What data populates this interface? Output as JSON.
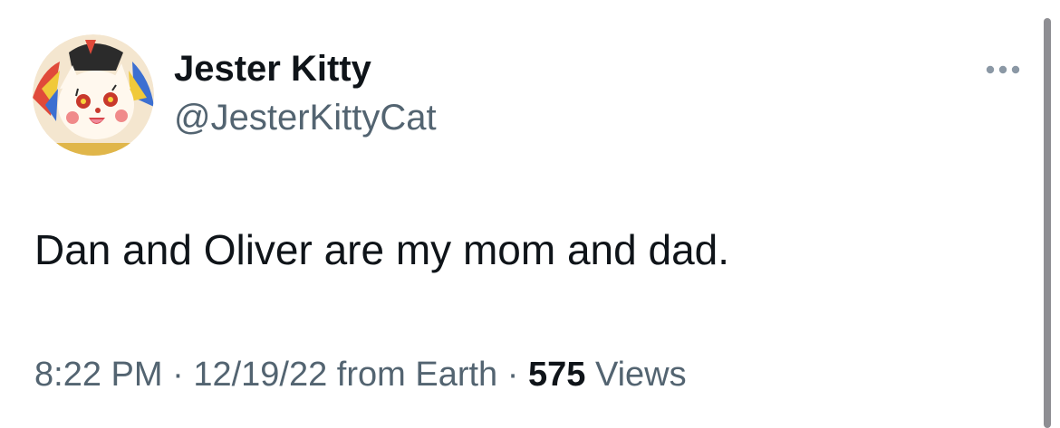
{
  "tweet": {
    "display_name": "Jester Kitty",
    "handle": "@JesterKittyCat",
    "text": "Dan and Oliver are my mom and dad.",
    "time": "8:22 PM",
    "separator": "·",
    "date": "12/19/22",
    "source": "from Earth",
    "views_count": "575",
    "views_label": "Views",
    "avatar_icon": "jester-cat-avatar",
    "more_icon": "more-dots-icon"
  },
  "colors": {
    "text_primary": "#0f1419",
    "text_secondary": "#536471",
    "background": "#ffffff"
  }
}
